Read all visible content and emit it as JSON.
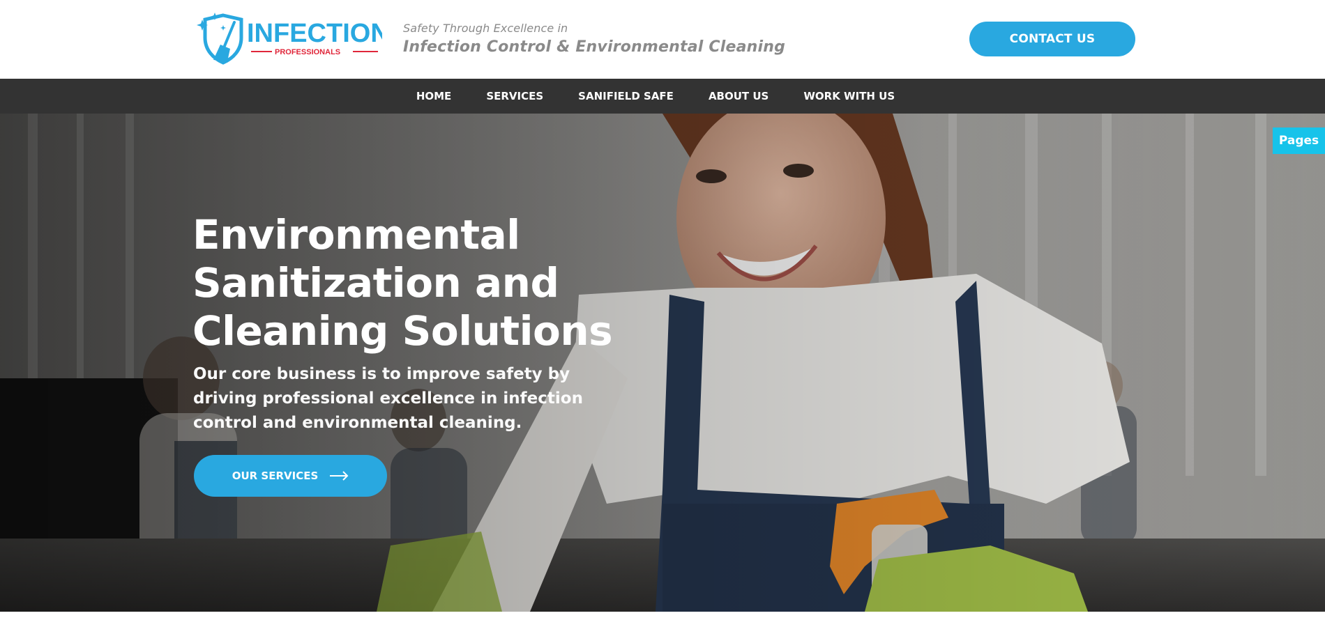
{
  "header": {
    "logo": {
      "brand": "INFECTION",
      "sub": "PROFESSIONALS",
      "icon": "shield-broom-icon",
      "primary_color": "#29a8e0",
      "accent_color": "#e0263a"
    },
    "tagline_small": "Safety Through Excellence in",
    "tagline_big": "Infection Control & Environmental Cleaning",
    "contact_label": "CONTACT US"
  },
  "nav": {
    "items": [
      {
        "label": "HOME"
      },
      {
        "label": "SERVICES"
      },
      {
        "label": "SANIFIELD SAFE"
      },
      {
        "label": "ABOUT US"
      },
      {
        "label": "WORK WITH US"
      }
    ],
    "background": "#333333"
  },
  "hero": {
    "title": "Environmental Sanitization and Cleaning Solutions",
    "subtitle": "Our core business is to improve safety by driving professional excellence in infection control and environmental cleaning.",
    "button_label": "OUR SERVICES",
    "button_icon": "arrow-right-icon"
  },
  "side_tab": {
    "label": "Pages",
    "color": "#17c3ea"
  },
  "colors": {
    "accent": "#29a8e0"
  }
}
